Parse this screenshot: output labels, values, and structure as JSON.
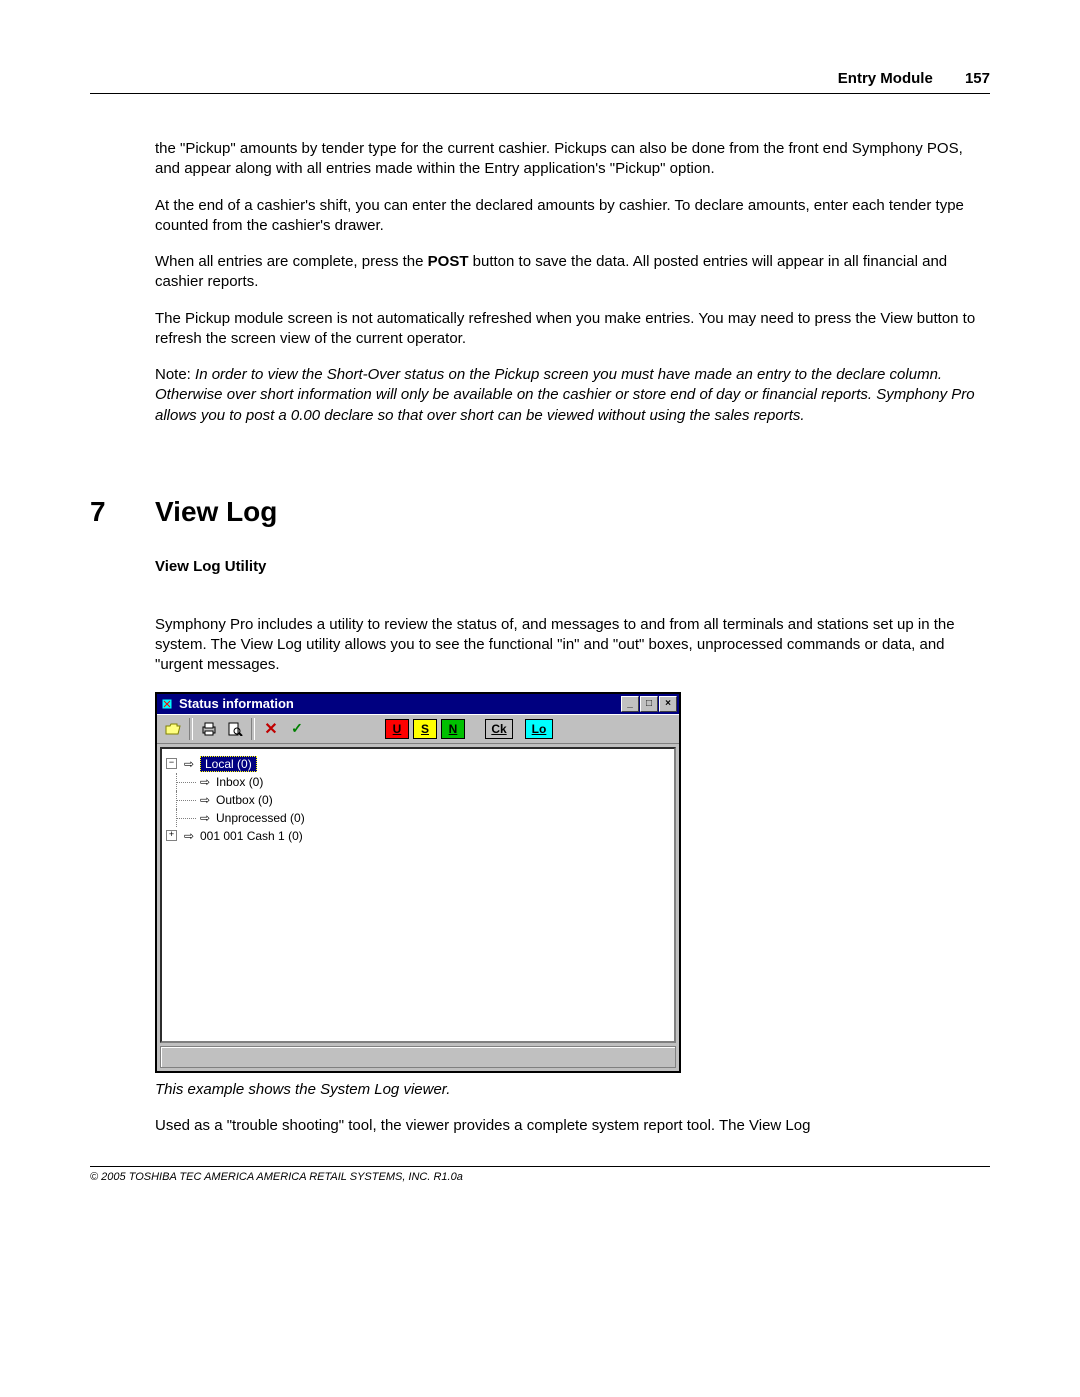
{
  "header": {
    "chapter": "Entry Module",
    "page": "157"
  },
  "para1": "the \"Pickup\" amounts by tender type for the current cashier. Pickups can also be done from the front end Symphony POS, and appear along with all entries made within the Entry application's \"Pickup\" option.",
  "para2": " At the end of a cashier's shift, you can enter the declared amounts by cashier. To declare amounts, enter each tender type counted from the cashier's drawer.",
  "para3a": " When all entries are complete, press the ",
  "para3b": "POST",
  "para3c": " button to save the data. All posted entries will appear in all financial and cashier reports.",
  "para4": " The Pickup module screen is not automatically refreshed when you make entries. You may need to press the View button to refresh the screen view of the current operator.",
  "note_label": " Note: ",
  "note_body": "In order to view the Short-Over status on the Pickup screen you must have made an entry to the declare column. Otherwise over short information will only be available on the cashier or store end of day or financial reports. Symphony Pro allows you to post a 0.00 declare so that over short can be viewed without using the sales reports.",
  "section": {
    "num": "7",
    "title": "View Log"
  },
  "subhead": "View Log Utility",
  "para5": " Symphony Pro includes a utility to review the status of, and messages to and from all terminals and stations set up in the system.  The View Log utility allows you to see the functional \"in\" and \"out\" boxes, unprocessed commands or data, and \"urgent messages.",
  "window": {
    "title": "Status information",
    "pills": {
      "u": "U",
      "s": "S",
      "n": "N",
      "ck": "Ck",
      "lo": "Lo"
    },
    "tree": {
      "root": "Local (0)",
      "inbox": "Inbox (0)",
      "outbox": "Outbox (0)",
      "unprocessed": "Unprocessed (0)",
      "cash": "001 001  Cash 1 (0)"
    }
  },
  "caption": "This example shows the System Log viewer.",
  "para6": " Used as a \"trouble shooting\" tool, the viewer provides a complete system report tool. The View Log",
  "footer": "© 2005 TOSHIBA TEC AMERICA AMERICA RETAIL SYSTEMS, INC.   R1.0a"
}
